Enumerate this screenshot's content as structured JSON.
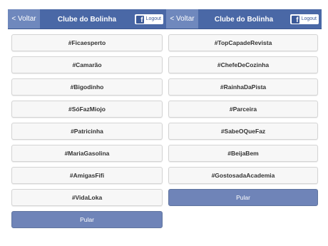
{
  "left": {
    "back_label": "< Voltar",
    "title": "Clube do Bolinha",
    "logout_label": "Logout",
    "fb_glyph": "f",
    "tags": [
      "#Ficaesperto",
      "#Camarão",
      "#Bigodinho",
      "#SóFazMiojo",
      "#Patricinha",
      "#MariaGasolina",
      "#AmigasFifi",
      "#VidaLoka"
    ],
    "skip_label": "Pular"
  },
  "right": {
    "back_label": "< Voltar",
    "title": "Clube do Bolinha",
    "logout_label": "Logout",
    "fb_glyph": "f",
    "tags": [
      "#TopCapadeRevista",
      "#ChefeDeCozinha",
      "#RainhaDaPista",
      "#Parceira",
      "#SabeOQueFaz",
      "#BeijaBem",
      "#GostosadaAcademia"
    ],
    "skip_label": "Pular"
  },
  "colors": {
    "navbar": "#4a68a6",
    "back_button": "#6f88bd",
    "skip_button": "#6f84b8",
    "facebook": "#3b5998"
  },
  "icons": {
    "facebook": "facebook-icon"
  }
}
